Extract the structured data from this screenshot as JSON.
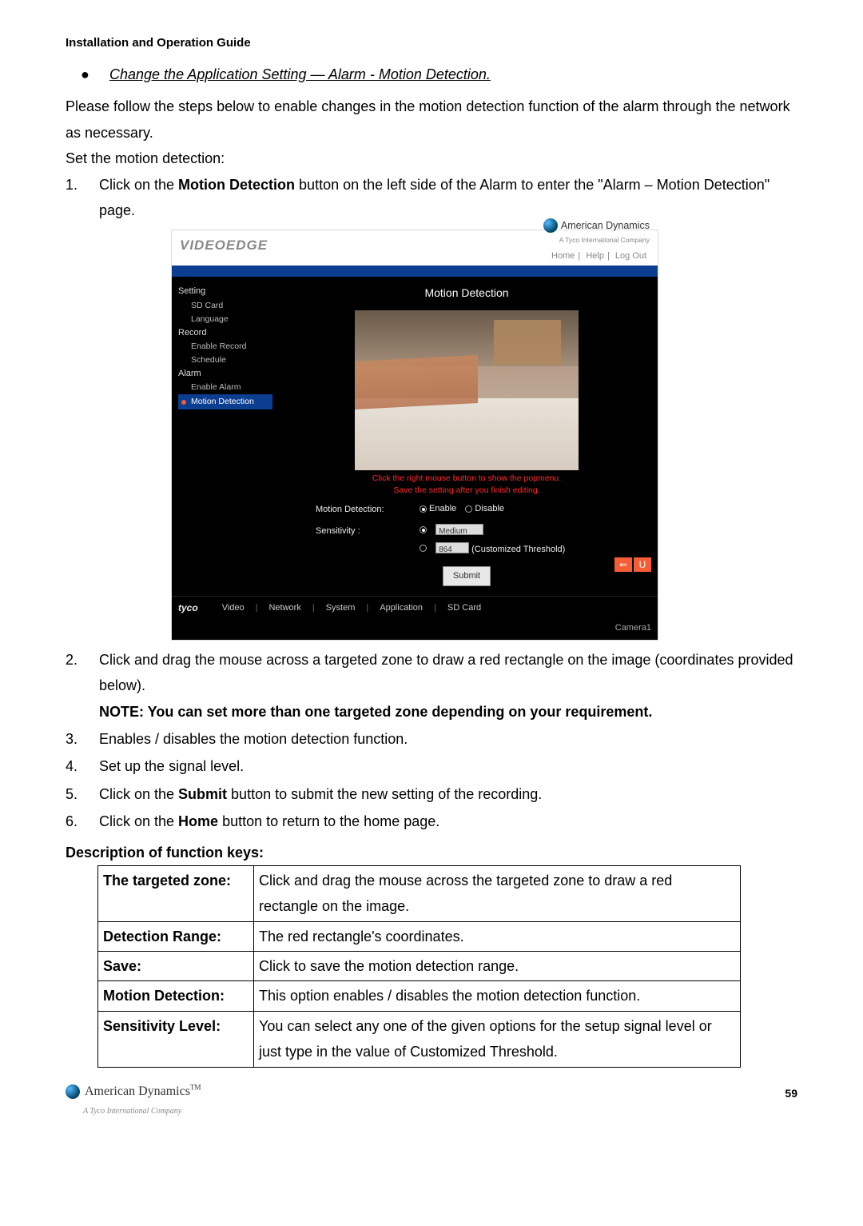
{
  "header": "Installation and Operation Guide",
  "section_title": "Change the Application Setting — Alarm - Motion Detection.",
  "intro1": "Please follow the steps below to enable changes in the motion detection function of the alarm through the network as necessary.",
  "intro2": "Set the motion detection:",
  "steps": {
    "s1_pre": "Click on the ",
    "s1_bold": "Motion Detection",
    "s1_post": " button on the left side of the Alarm to enter the \"Alarm – Motion Detection\" page.",
    "s2": "Click and drag the mouse across a targeted zone to draw a red rectangle on the image (coordinates provided below).",
    "note": "NOTE: You can set more than one targeted zone depending on your requirement.",
    "s3": "Enables / disables the motion detection function.",
    "s4": "Set up the signal level.",
    "s5_pre": "Click on the ",
    "s5_bold": "Submit",
    "s5_post": " button to submit the new setting of the recording.",
    "s6_pre": "Click on the ",
    "s6_bold": "Home",
    "s6_post": " button to return to the home page."
  },
  "screenshot": {
    "logo_left": "VideoEdge",
    "brand_name": "American Dynamics",
    "brand_sub": "A Tyco International Company",
    "toplinks": {
      "home": "Home",
      "help": "Help",
      "logout": "Log Out"
    },
    "title": "Motion Detection",
    "sidebar": {
      "setting": "Setting",
      "sd_card": "SD Card",
      "language": "Language",
      "record": "Record",
      "enable_record": "Enable Record",
      "schedule": "Schedule",
      "alarm": "Alarm",
      "enable_alarm": "Enable Alarm",
      "motion_detection": "Motion Detection"
    },
    "hint1": "Click the right mouse button to show the popmenu.",
    "hint2": "Save the setting after you finish editing.",
    "form": {
      "md_label": "Motion Detection:",
      "enable": "Enable",
      "disable": "Disable",
      "sens_label": "Sensitivity :",
      "sens_preset": "Medium",
      "custom_val": "864",
      "custom_text": "(Customized Threshold)",
      "submit": "Submit"
    },
    "bottom": {
      "brand": "tyco",
      "video": "Video",
      "network": "Network",
      "system": "System",
      "application": "Application",
      "sdcard": "SD Card"
    },
    "camera": "Camera1",
    "back_icon": "⇐",
    "undo_icon": "U"
  },
  "desc_title": "Description of function keys:",
  "table": {
    "r1k": "The targeted zone:",
    "r1v": "Click and drag the mouse across the targeted zone to draw a red rectangle on the image.",
    "r2k": "Detection Range:",
    "r2v": "The red rectangle's coordinates.",
    "r3k": "Save:",
    "r3v": "Click to save the motion detection range.",
    "r4k": "Motion Detection:",
    "r4v": "This option enables / disables the motion detection function.",
    "r5k": "Sensitivity Level:",
    "r5v": "You can select any one of the given options for the setup signal level or just type in the value of Customized Threshold."
  },
  "footer": {
    "brand": "American Dynamics",
    "tm": "TM",
    "sub": "A Tyco International Company",
    "page": "59"
  }
}
